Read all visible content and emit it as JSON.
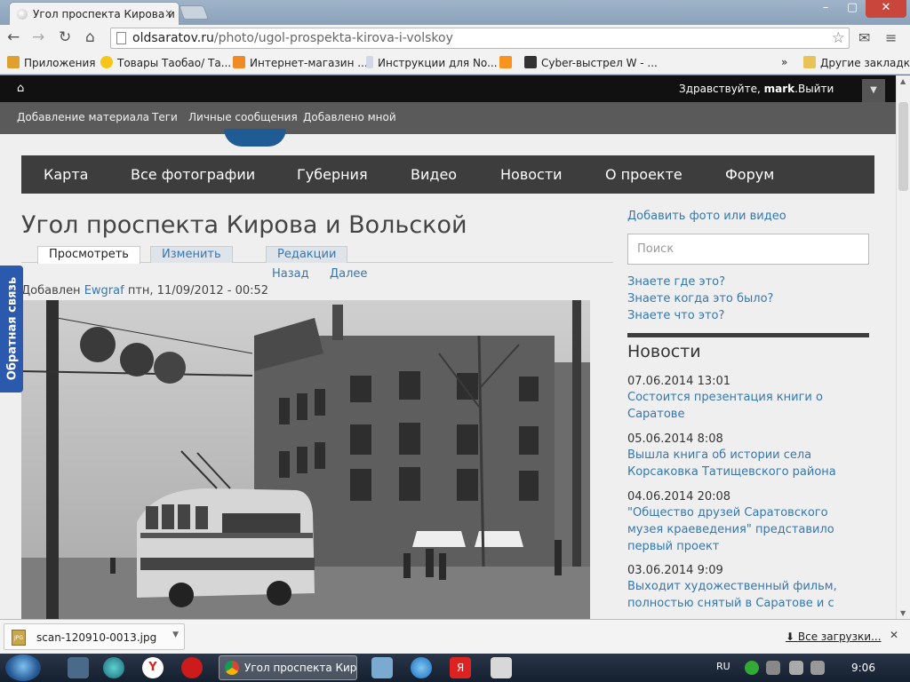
{
  "browser": {
    "tab_title": "Угол проспекта Кирова и",
    "tab_close": "×",
    "url_host": "oldsaratov.ru",
    "url_path": "/photo/ugol-prospekta-kirova-i-volskoy",
    "bookmarks": [
      {
        "label": "Приложения",
        "color": "#e0a030"
      },
      {
        "label": "Товары Таобао/ Та...",
        "color": "#f5c518"
      },
      {
        "label": "Интернет-магазин ...",
        "color": "#f08a24"
      },
      {
        "label": "Инструкции для No...",
        "color": "#d0d8e8"
      },
      {
        "label": "",
        "color": "#f7931e"
      },
      {
        "label": "Cyber-выстрел W - ...",
        "color": "#333333"
      }
    ],
    "bookmarks_more": "»",
    "other_bookmarks": "Другие закладки",
    "window_buttons": [
      "–",
      "▢",
      "✕"
    ]
  },
  "site": {
    "admin_home_icon": "home-icon",
    "greeting": "Здравствуйте,",
    "username": "mark",
    "logout": "Выйти",
    "dropdown": "▼",
    "sub_links": [
      "Добавление материала",
      "Теги",
      "Личные сообщения",
      "Добавлено мной"
    ],
    "main_nav": [
      "Карта",
      "Все фотографии",
      "Губерния",
      "Видео",
      "Новости",
      "О проекте",
      "Форум"
    ],
    "feedback": "Обратная связь"
  },
  "article": {
    "title": "Угол проспекта Кирова и Вольской",
    "tabs": [
      "Просмотреть",
      "Изменить",
      "Редакции"
    ],
    "prev": "Назад",
    "next": "Далее",
    "added_prefix": "Добавлен",
    "author": "Ewgraf",
    "date": "птн, 11/09/2012 - 00:52"
  },
  "sidebar": {
    "add_media": "Добавить фото или видео",
    "search_placeholder": "Поиск",
    "know_links": [
      "Знаете где это?",
      "Знаете когда это было?",
      "Знаете что это?"
    ],
    "news_heading": "Новости",
    "news": [
      {
        "date": "07.06.2014 13:01",
        "title": "Состоится презентация книги о Саратове"
      },
      {
        "date": "05.06.2014 8:08",
        "title": "Вышла книга об истории села Корсаковка Татищевского района"
      },
      {
        "date": "04.06.2014 20:08",
        "title": "\"Общество друзей Саратовского музея краеведения\" представило первый проект"
      },
      {
        "date": "03.06.2014 9:09",
        "title": "Выходит художественный фильм, полностью снятый в Саратове и с"
      }
    ]
  },
  "downloads": {
    "file_name": "scan-120910-0013.jpg",
    "file_badge": "JPG",
    "all_downloads": "Все загрузки..."
  },
  "taskbar": {
    "active_window": "Угол проспекта Кир...",
    "language": "RU",
    "time": "9:06"
  }
}
